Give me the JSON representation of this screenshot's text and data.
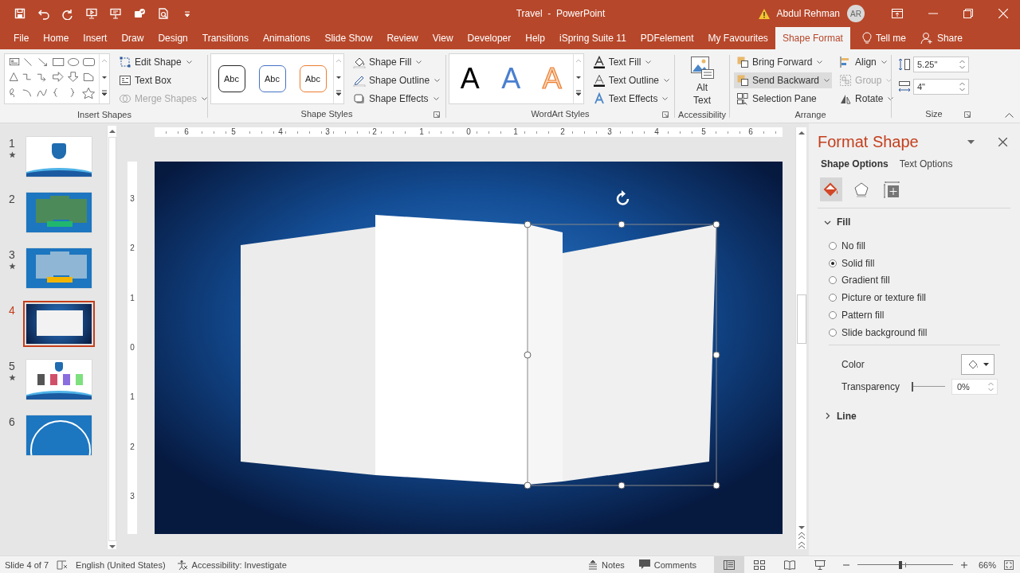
{
  "title_bar": {
    "title": "Travel  -  PowerPoint",
    "user": {
      "name": "Abdul Rehman",
      "initials": "AR"
    }
  },
  "tabs": [
    {
      "label": "File",
      "selected": false
    },
    {
      "label": "Home",
      "selected": false
    },
    {
      "label": "Insert",
      "selected": false
    },
    {
      "label": "Draw",
      "selected": false
    },
    {
      "label": "Design",
      "selected": false
    },
    {
      "label": "Transitions",
      "selected": false
    },
    {
      "label": "Animations",
      "selected": false
    },
    {
      "label": "Slide Show",
      "selected": false
    },
    {
      "label": "Review",
      "selected": false
    },
    {
      "label": "View",
      "selected": false
    },
    {
      "label": "Developer",
      "selected": false
    },
    {
      "label": "Help",
      "selected": false
    },
    {
      "label": "iSpring Suite 11",
      "selected": false
    },
    {
      "label": "PDFelement",
      "selected": false
    },
    {
      "label": "My Favourites",
      "selected": false
    },
    {
      "label": "Shape Format",
      "selected": true
    }
  ],
  "tell_me": "Tell me",
  "share": "Share",
  "ribbon": {
    "insert_shapes": {
      "label": "Insert Shapes",
      "commands": [
        {
          "label": "Edit Shape",
          "dropdown": true,
          "disabled": false
        },
        {
          "label": "Text Box",
          "dropdown": false,
          "disabled": false
        },
        {
          "label": "Merge Shapes",
          "dropdown": true,
          "disabled": true
        }
      ]
    },
    "shape_styles": {
      "label": "Shape Styles",
      "presets": [
        {
          "text": "Abc",
          "color": "#262626"
        },
        {
          "text": "Abc",
          "color": "#4472c4"
        },
        {
          "text": "Abc",
          "color": "#ed7d31"
        }
      ],
      "commands": [
        {
          "label": "Shape Fill",
          "dropdown": true,
          "disabled": false
        },
        {
          "label": "Shape Outline",
          "dropdown": true,
          "disabled": false
        },
        {
          "label": "Shape Effects",
          "dropdown": true,
          "disabled": false
        }
      ]
    },
    "wordart_styles": {
      "label": "WordArt Styles",
      "presets": [
        {
          "text": "A",
          "kind": "solid-black"
        },
        {
          "text": "A",
          "kind": "gradient-blue"
        },
        {
          "text": "A",
          "kind": "outline-orange"
        }
      ],
      "commands": [
        {
          "label": "Text Fill",
          "dropdown": true,
          "disabled": false
        },
        {
          "label": "Text Outline",
          "dropdown": true,
          "disabled": false
        },
        {
          "label": "Text Effects",
          "dropdown": true,
          "disabled": false
        }
      ]
    },
    "accessibility": {
      "label": "Accessibility",
      "command": "Alt Text"
    },
    "arrange": {
      "label": "Arrange",
      "commands": [
        {
          "label": "Bring Forward",
          "dropdown": true,
          "disabled": false,
          "highlighted": false
        },
        {
          "label": "Send Backward",
          "dropdown": true,
          "disabled": false,
          "highlighted": true
        },
        {
          "label": "Selection Pane",
          "dropdown": false,
          "disabled": false,
          "highlighted": false
        },
        {
          "label": "Align",
          "dropdown": true,
          "disabled": false,
          "highlighted": false
        },
        {
          "label": "Group",
          "dropdown": true,
          "disabled": true,
          "highlighted": false
        },
        {
          "label": "Rotate",
          "dropdown": true,
          "disabled": false,
          "highlighted": false
        }
      ]
    },
    "size": {
      "label": "Size",
      "height": "5.25\"",
      "width": "4\""
    }
  },
  "slides": [
    {
      "number": "1",
      "animated": true,
      "selected": false,
      "kind": "logo"
    },
    {
      "number": "2",
      "animated": false,
      "selected": false,
      "kind": "photos"
    },
    {
      "number": "3",
      "animated": true,
      "selected": false,
      "kind": "photos-banner"
    },
    {
      "number": "4",
      "animated": false,
      "selected": true,
      "kind": "panels"
    },
    {
      "number": "5",
      "animated": true,
      "selected": false,
      "kind": "icons"
    },
    {
      "number": "6",
      "animated": false,
      "selected": false,
      "kind": "arc"
    }
  ],
  "rulers": {
    "horizontal": [
      "6",
      "5",
      "4",
      "3",
      "2",
      "1",
      "0",
      "1",
      "2",
      "3",
      "4",
      "5",
      "6"
    ],
    "vertical": [
      "3",
      "2",
      "1",
      "0",
      "1",
      "2",
      "3"
    ]
  },
  "format_pane": {
    "title": "Format Shape",
    "tabs": [
      {
        "label": "Shape Options",
        "selected": true
      },
      {
        "label": "Text Options",
        "selected": false
      }
    ],
    "icon_tabs": [
      {
        "kind": "fill",
        "selected": true
      },
      {
        "kind": "effects",
        "selected": false
      },
      {
        "kind": "size",
        "selected": false
      }
    ],
    "fill": {
      "label": "Fill",
      "expanded": true,
      "options": [
        {
          "label": "No fill",
          "selected": false
        },
        {
          "label": "Solid fill",
          "selected": true
        },
        {
          "label": "Gradient fill",
          "selected": false
        },
        {
          "label": "Picture or texture fill",
          "selected": false
        },
        {
          "label": "Pattern fill",
          "selected": false
        },
        {
          "label": "Slide background fill",
          "selected": false
        }
      ],
      "color_label": "Color",
      "transparency_label": "Transparency",
      "transparency": {
        "level": 0,
        "value": "0%"
      }
    },
    "line": {
      "label": "Line",
      "expanded": false
    }
  },
  "status_bar": {
    "slide": "Slide 4 of 7",
    "language": "English (United States)",
    "accessibility": "Accessibility: Investigate",
    "notes": "Notes",
    "comments": "Comments",
    "views": [
      {
        "kind": "normal",
        "selected": true
      },
      {
        "kind": "sorter",
        "selected": false
      },
      {
        "kind": "reading",
        "selected": false
      },
      {
        "kind": "slideshow",
        "selected": false
      }
    ],
    "zoom": {
      "level": 0.45,
      "value": "66%"
    }
  }
}
